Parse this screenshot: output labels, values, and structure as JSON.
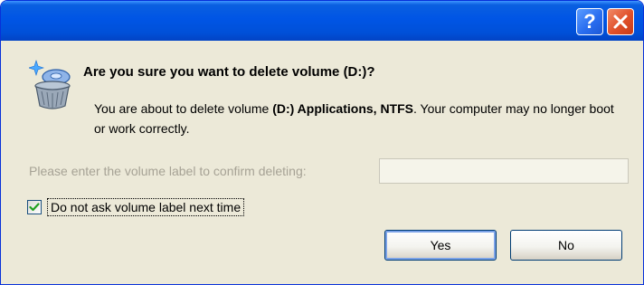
{
  "titlebar": {
    "help_icon": "question-mark-icon",
    "help_label": "?",
    "close_icon": "close-x-icon"
  },
  "dialog": {
    "icon": "recycle-bin-delete-icon",
    "question": "Are you sure you want to delete volume (D:)?",
    "message_prefix": "You are about to delete volume ",
    "message_volume": "(D:) Applications, NTFS",
    "message_suffix": ". Your computer may no longer boot or work correctly.",
    "confirm_label": "Please enter the volume label to confirm deleting:",
    "confirm_value": "",
    "checkbox_label": "Do not ask volume label next time",
    "checkbox_checked": true,
    "yes_label": "Yes",
    "no_label": "No"
  },
  "colors": {
    "titlebar": "#0055e5",
    "dialog_bg": "#ece9d8",
    "close_button": "#e0502a",
    "disabled_text": "#a6a295",
    "checkmark": "#21a121"
  }
}
